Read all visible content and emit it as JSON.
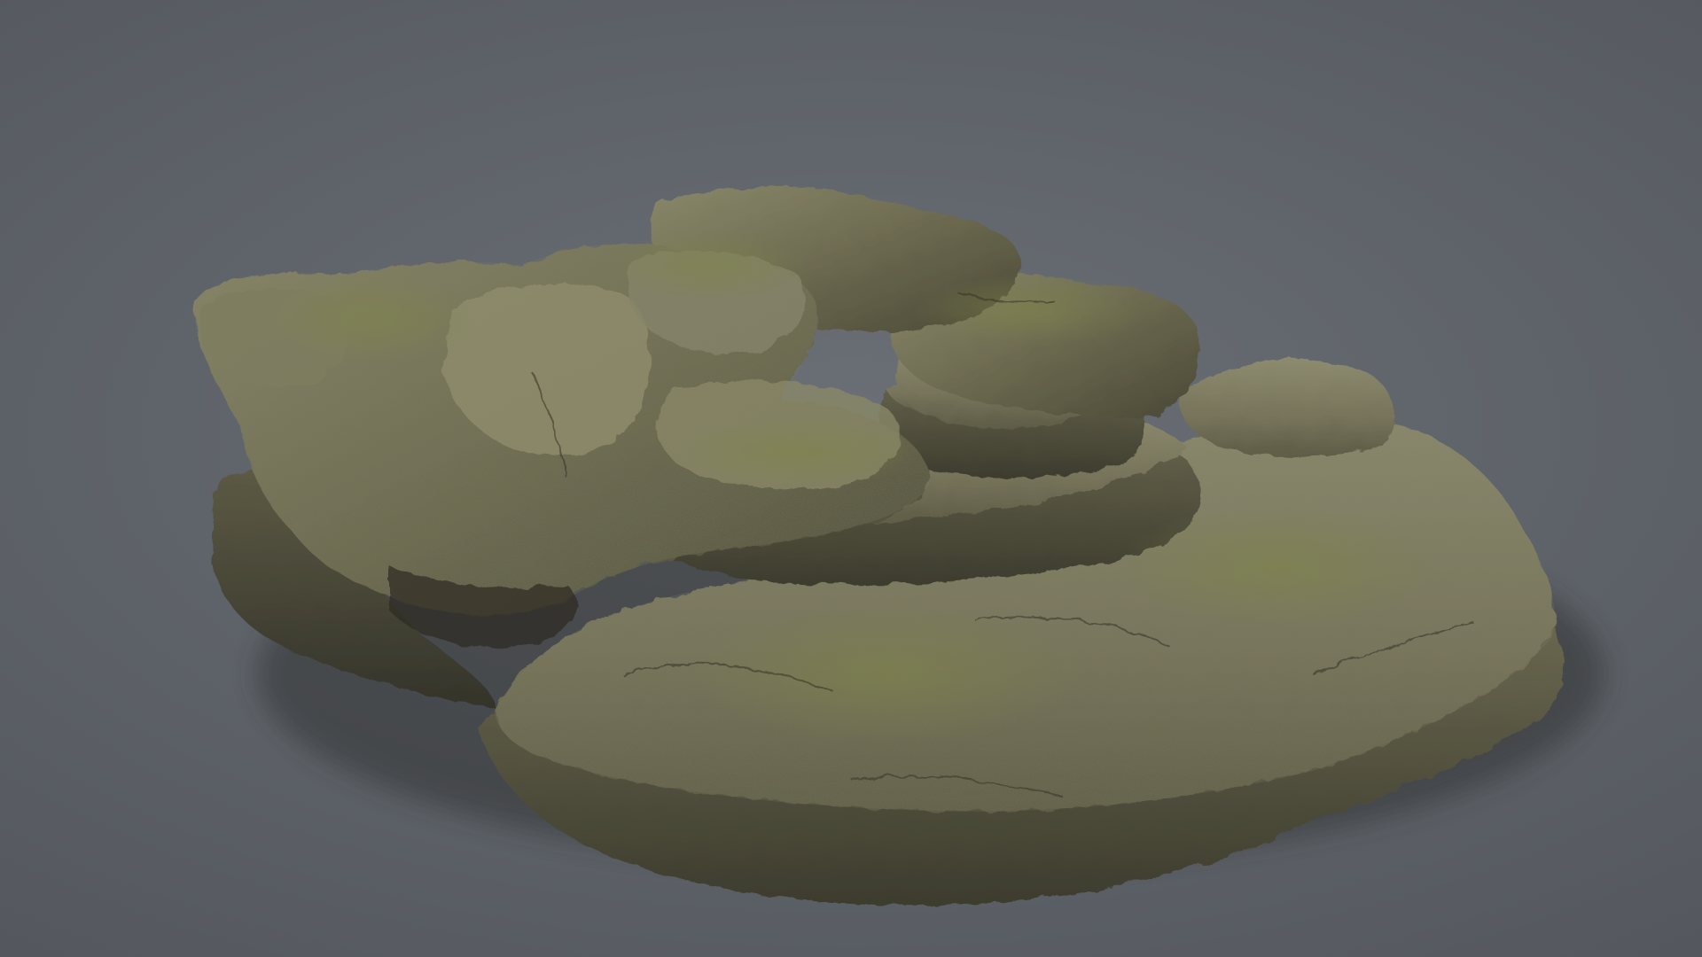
{
  "scene": {
    "subject": "mossy-rock-formation",
    "colors": {
      "background_center": "#6b7076",
      "background_edge": "#54585e",
      "rock_light": "#8b8a6e",
      "rock_mid": "#6e6c52",
      "rock_dark": "#3f3d2e",
      "moss": "#7a8046",
      "shadow": "#2c2c26"
    }
  }
}
